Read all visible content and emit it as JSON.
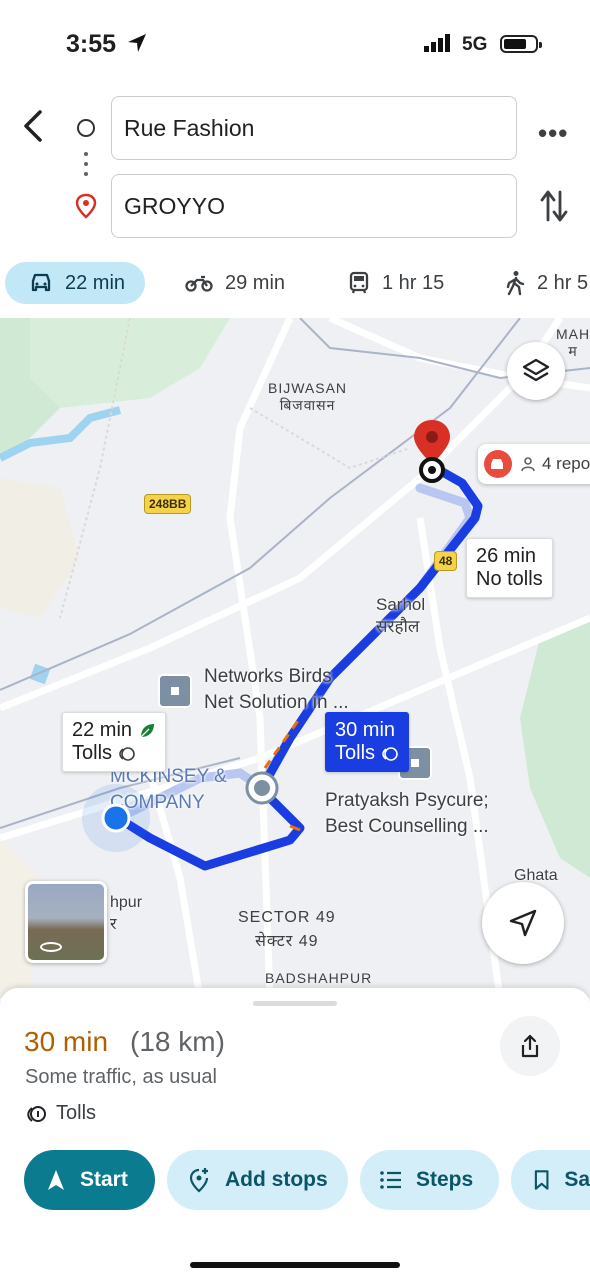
{
  "status_bar": {
    "time": "3:55",
    "network": "5G"
  },
  "route_inputs": {
    "origin": "Rue Fashion",
    "destination": "GROYYO"
  },
  "modes": [
    {
      "name": "drive",
      "label": "22 min",
      "selected": true
    },
    {
      "name": "motorbike",
      "label": "29 min",
      "selected": false
    },
    {
      "name": "transit",
      "label": "1 hr 15",
      "selected": false
    },
    {
      "name": "walk",
      "label": "2 hr 5",
      "selected": false
    }
  ],
  "map": {
    "place_labels": {
      "bijwasan": "BIJWASAN",
      "bijwasan_hi": "बिजवासन",
      "sarhol": "Sarhol",
      "sarhol_hi": "सरहौल",
      "sector49": "SECTOR 49",
      "sector49_hi": "सेक्टर 49",
      "badshahpur": "BADSHAHPUR",
      "ghata": "Ghata",
      "mah": "MAH",
      "mah_hi": "म",
      "hpur": "hpur",
      "hpur_hi": "र"
    },
    "highway_shields": [
      "248BB",
      "48"
    ],
    "pois": {
      "networks_birds": "Networks Birds\nNet Solution in ...",
      "mckinsey": "MCKINSEY &\nCOMPANY",
      "pratyaksh": "Pratyaksh Psycure;\nBest Counselling ..."
    },
    "report_chip": "4 repo",
    "callouts": {
      "alt1_time": "26 min",
      "alt1_note": "No tolls",
      "alt2_time": "22 min",
      "alt2_note": "Tolls",
      "selected_time": "30 min",
      "selected_note": "Tolls"
    },
    "colors": {
      "route": "#1a3de2",
      "alt_route": "#a9b9ec",
      "destination_pin": "#d93025",
      "origin_dot": "#1a73e8"
    }
  },
  "summary": {
    "duration": "30 min",
    "distance": "(18 km)",
    "traffic": "Some traffic, as usual",
    "tolls": "Tolls"
  },
  "actions": {
    "start": "Start",
    "add_stops": "Add stops",
    "steps": "Steps",
    "save": "Sa"
  }
}
